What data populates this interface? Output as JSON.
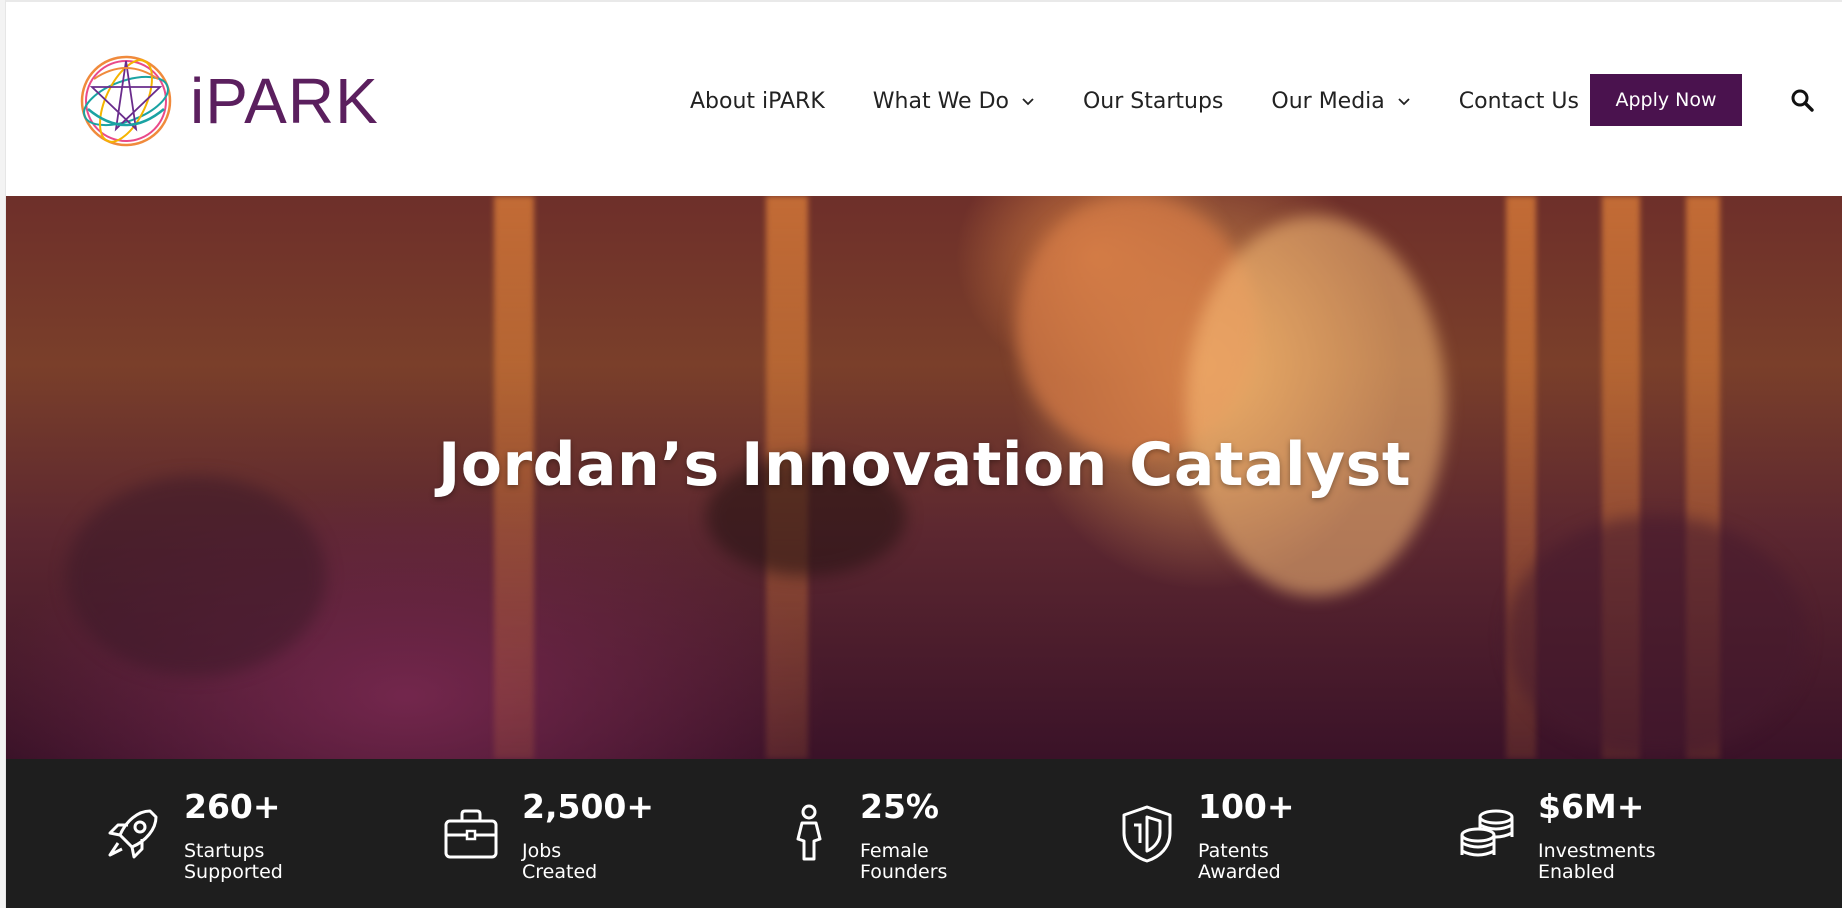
{
  "header": {
    "logo_text": "iPARK",
    "nav": [
      {
        "label": "About iPARK",
        "has_dropdown": false
      },
      {
        "label": "What We Do",
        "has_dropdown": true
      },
      {
        "label": "Our Startups",
        "has_dropdown": false
      },
      {
        "label": "Our Media",
        "has_dropdown": true
      },
      {
        "label": "Contact Us",
        "has_dropdown": false
      }
    ],
    "apply_label": "Apply Now",
    "search_icon": "search-icon"
  },
  "hero": {
    "title": "Jordan’s Innovation Catalyst"
  },
  "stats": [
    {
      "icon": "rocket-icon",
      "value": "260+",
      "label_line1": "Startups",
      "label_line2": "Supported"
    },
    {
      "icon": "briefcase-icon",
      "value": "2,500+",
      "label_line1": "Jobs",
      "label_line2": "Created"
    },
    {
      "icon": "female-icon",
      "value": "25%",
      "label_line1": "Female",
      "label_line2": "Founders"
    },
    {
      "icon": "shield-icon",
      "value": "100+",
      "label_line1": "Patents",
      "label_line2": "Awarded"
    },
    {
      "icon": "coins-icon",
      "value": "$6M+",
      "label_line1": "Investments",
      "label_line2": "Enabled"
    }
  ],
  "colors": {
    "brand_purple": "#4a124e",
    "logo_purple": "#5b1f5e",
    "stats_background": "#1e1e1e"
  }
}
